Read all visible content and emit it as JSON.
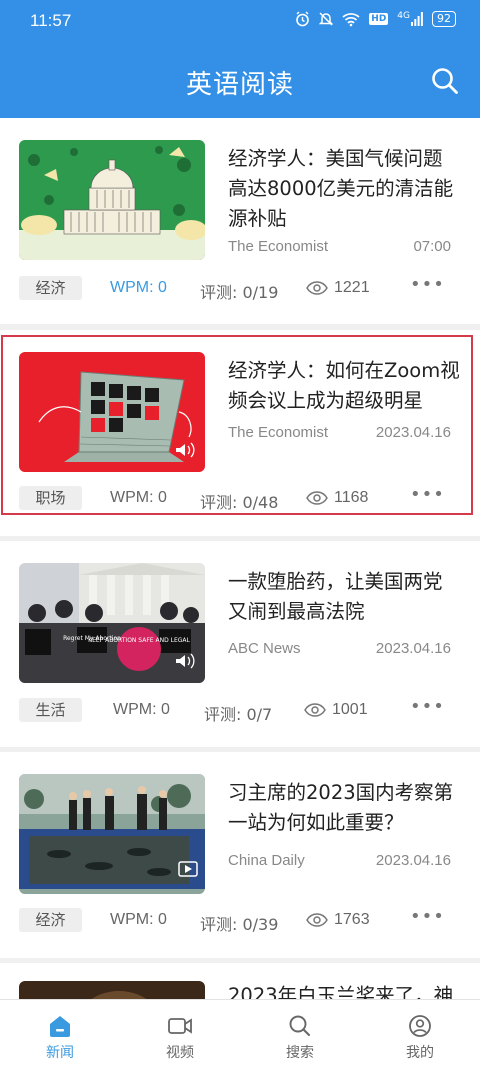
{
  "status_bar": {
    "time": "11:57",
    "battery": "92",
    "network": "4G",
    "hd": "HD"
  },
  "app": {
    "title": "英语阅读"
  },
  "articles": [
    {
      "title": "经济学人：美国气候问题高达8000亿美元的清洁能源补贴",
      "source": "The Economist",
      "date": "07:00",
      "tag": "经济",
      "wpm": "WPM: 0",
      "eval": "评测: 0/19",
      "views": "1221"
    },
    {
      "title": "经济学人：如何在Zoom视频会议上成为超级明星",
      "source": "The Economist",
      "date": "2023.04.16",
      "tag": "职场",
      "wpm": "WPM: 0",
      "eval": "评测: 0/48",
      "views": "1168"
    },
    {
      "title": "一款堕胎药，让美国两党又闹到最高法院",
      "source": "ABC News",
      "date": "2023.04.16",
      "tag": "生活",
      "wpm": "WPM: 0",
      "eval": "评测: 0/7",
      "views": "1001"
    },
    {
      "title": "习主席的2023国内考察第一站为何如此重要？",
      "source": "China Daily",
      "date": "2023.04.16",
      "tag": "经济",
      "wpm": "WPM: 0",
      "eval": "评测: 0/39",
      "views": "1763"
    },
    {
      "title": "2023年白玉兰奖来了，神"
    }
  ],
  "thumb_text": {
    "protest_sign": "KEEP ABORTION SAFE AND LEGAL",
    "regret_sign": "Regret My Abortion"
  },
  "tabs": [
    {
      "label": "新闻",
      "icon": "news-icon"
    },
    {
      "label": "视频",
      "icon": "video-icon"
    },
    {
      "label": "搜索",
      "icon": "search-icon"
    },
    {
      "label": "我的",
      "icon": "profile-icon"
    }
  ],
  "colors": {
    "primary": "#3390e6",
    "accent": "#3a9ae0",
    "highlight": "#d63a4a"
  }
}
